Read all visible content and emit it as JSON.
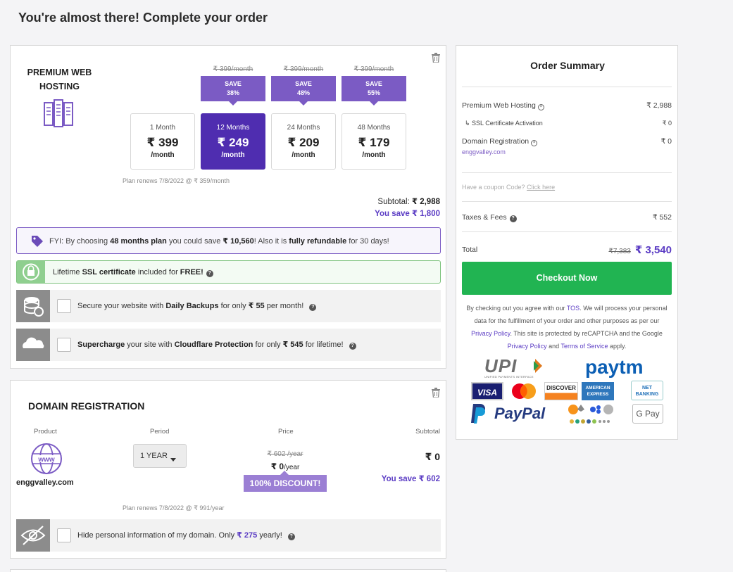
{
  "page": {
    "title": "You're almost there! Complete your order"
  },
  "hosting": {
    "product_title": "PREMIUM WEB HOSTING",
    "plans": [
      {
        "label": "1 Month",
        "price": "₹ 399",
        "per": "/month",
        "old_price": "",
        "save_label": "",
        "save_pct": "",
        "selected": false
      },
      {
        "label": "12 Months",
        "price": "₹ 249",
        "per": "/month",
        "old_price": "₹ 399/month",
        "save_label": "SAVE",
        "save_pct": "38%",
        "selected": true
      },
      {
        "label": "24 Months",
        "price": "₹ 209",
        "per": "/month",
        "old_price": "₹ 399/month",
        "save_label": "SAVE",
        "save_pct": "48%",
        "selected": false
      },
      {
        "label": "48 Months",
        "price": "₹ 179",
        "per": "/month",
        "old_price": "₹ 399/month",
        "save_label": "SAVE",
        "save_pct": "55%",
        "selected": false
      }
    ],
    "renew_text": "Plan renews 7/8/2022 @ ₹ 359/month",
    "subtotal_label": "Subtotal:",
    "subtotal_value": "₹ 2,988",
    "you_save": "You save ₹ 1,800",
    "fyi": {
      "prefix": "FYI: By choosing ",
      "plan": "48 months plan",
      "mid": " you could save ",
      "amount": "₹ 10,560",
      "mid2": "! Also it is ",
      "refund": "fully refundable",
      "suffix": " for 30 days!"
    },
    "ssl": {
      "prefix": "Lifetime ",
      "bold1": "SSL certificate",
      "mid": " included for ",
      "bold2": "FREE!"
    },
    "addons": [
      {
        "prefix": "Secure your website with ",
        "bold": "Daily Backups",
        "mid": " for only ",
        "price": "₹ 55",
        "suffix": " per month!"
      },
      {
        "bold1": "Supercharge",
        "mid": " your site with ",
        "bold": "Cloudflare Protection",
        "mid2": " for only ",
        "price": "₹ 545",
        "suffix": " for lifetime!"
      }
    ]
  },
  "domain": {
    "section_title": "DOMAIN REGISTRATION",
    "headers": {
      "product": "Product",
      "period": "Period",
      "price": "Price",
      "subtotal": "Subtotal"
    },
    "name": "enggvalley.com",
    "period": "1 YEAR",
    "old_price": "₹ 602 /year",
    "price": "₹ 0",
    "price_unit": "/year",
    "discount": "100% DISCOUNT!",
    "subtotal": "₹ 0",
    "you_save": "You save ₹ 602",
    "renew_text": "Plan renews 7/8/2022 @ ₹ 991/year",
    "privacy": {
      "prefix": "Hide personal information of my domain. Only ",
      "price": "₹ 275",
      "suffix": " yearly!"
    }
  },
  "summary": {
    "title": "Order Summary",
    "items": [
      {
        "label": "Premium Web Hosting",
        "value": "₹ 2,988"
      },
      {
        "label": "↳ SSL Certificate Activation",
        "value": "₹ 0"
      },
      {
        "label": "Domain Registration",
        "value": "₹ 0",
        "sub": "enggvalley.com"
      }
    ],
    "coupon_text": "Have a coupon Code?",
    "coupon_link": "Click here",
    "taxes_label": "Taxes & Fees",
    "taxes_value": "₹ 552",
    "total_label": "Total",
    "total_old": "₹7,383",
    "total_value": "₹ 3,540",
    "checkout_label": "Checkout Now",
    "legal": {
      "p1": "By checking out you agree with our ",
      "tos": "TOS",
      "p2": ". We will process your personal data for the fulfillment of your order and other purposes as per our ",
      "privacy": "Privacy Policy",
      "p3": ". This site is protected by reCAPTCHA and the Google ",
      "privacy2": "Privacy Policy",
      "p4": " and ",
      "terms": "Terms of Service",
      "p5": " apply."
    },
    "payment": {
      "upi": "UPI",
      "upi_sub": "UNIFIED PAYMENTS INTERFACE",
      "paytm": "paytm",
      "visa": "VISA",
      "discover": "DISCOVER",
      "amex": "AMERICAN EXPRESS",
      "netbanking": "NET BANKING",
      "paypal": "PayPal",
      "gpay": "G Pay"
    }
  },
  "colors": {
    "purple": "#7b5bc4",
    "dark_purple": "#4f2db0",
    "green": "#21b452"
  }
}
